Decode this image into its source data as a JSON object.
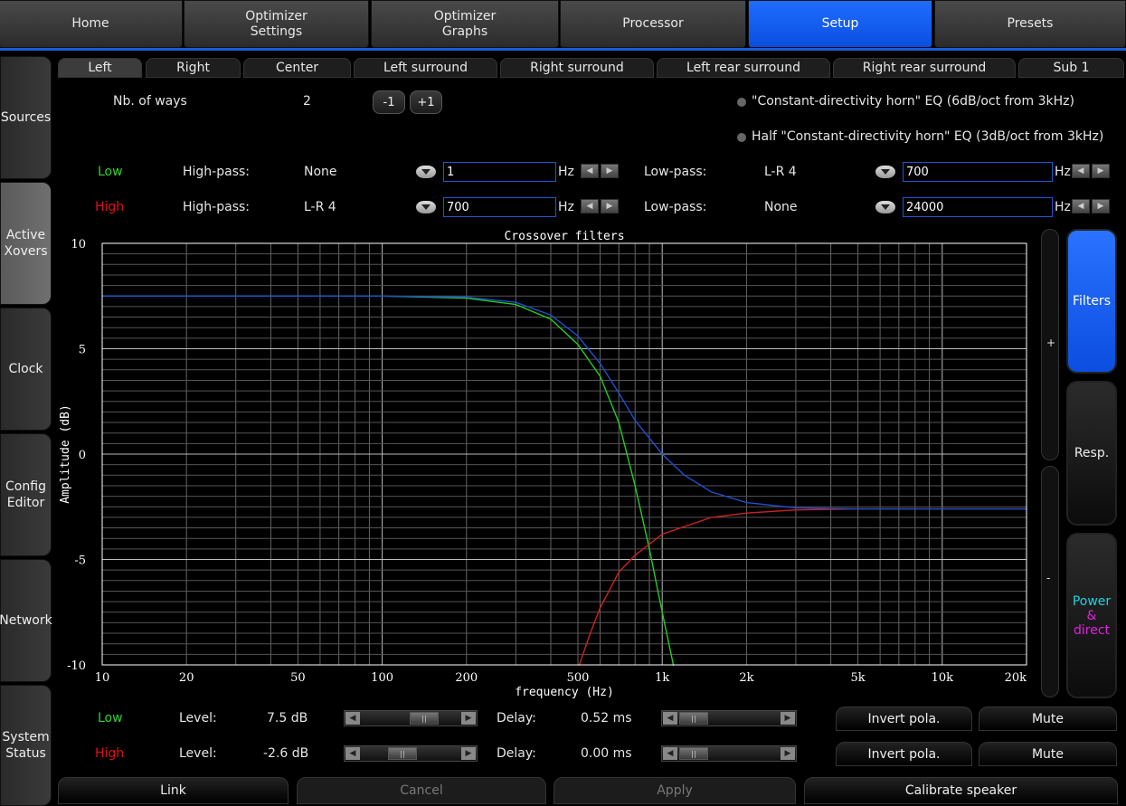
{
  "top_tabs": [
    {
      "label": "Home"
    },
    {
      "label": "Optimizer\nSettings"
    },
    {
      "label": "Optimizer\nGraphs"
    },
    {
      "label": "Processor"
    },
    {
      "label": "Setup",
      "active": true
    },
    {
      "label": "Presets"
    }
  ],
  "sidebar": [
    {
      "label": "Sources"
    },
    {
      "label": "Active\nXovers",
      "active": true
    },
    {
      "label": "Clock"
    },
    {
      "label": "Config\nEditor"
    },
    {
      "label": "Network"
    },
    {
      "label": "System\nStatus"
    }
  ],
  "channel_tabs": [
    "Left",
    "Right",
    "Center",
    "Left surround",
    "Right surround",
    "Left rear surround",
    "Right rear surround",
    "Sub 1"
  ],
  "active_channel": "Left",
  "ways": {
    "label": "Nb. of ways",
    "value": "2",
    "minus": "-1",
    "plus": "+1"
  },
  "eq_options": [
    "\"Constant-directivity horn\" EQ (6dB/oct from 3kHz)",
    "Half \"Constant-directivity horn\" EQ (3dB/oct from 3kHz)"
  ],
  "bands": [
    {
      "name": "Low",
      "color": "#2fd12f",
      "hp_label": "High-pass:",
      "hp_type": "None",
      "hp_freq": "1",
      "unit": "Hz",
      "lp_label": "Low-pass:",
      "lp_type": "L-R 4",
      "lp_freq": "700"
    },
    {
      "name": "High",
      "color": "#e01010",
      "hp_label": "High-pass:",
      "hp_type": "L-R 4",
      "hp_freq": "700",
      "unit": "Hz",
      "lp_label": "Low-pass:",
      "lp_type": "None",
      "lp_freq": "24000"
    }
  ],
  "levels": [
    {
      "name": "Low",
      "color": "#2fd12f",
      "level_label": "Level:",
      "level": "7.5 dB",
      "delay_label": "Delay:",
      "delay": "0.52 ms",
      "invert": "Invert pola.",
      "mute": "Mute"
    },
    {
      "name": "High",
      "color": "#e01010",
      "level_label": "Level:",
      "level": "-2.6 dB",
      "delay_label": "Delay:",
      "delay": "0.00 ms",
      "invert": "Invert pola.",
      "mute": "Mute"
    }
  ],
  "right_panel": {
    "plus": "+",
    "minus": "-",
    "filters": "Filters",
    "resp": "Resp.",
    "power_line1": "Power",
    "power_line2": "& direct"
  },
  "bottom": {
    "link": "Link",
    "cancel": "Cancel",
    "apply": "Apply",
    "calibrate": "Calibrate speaker"
  },
  "chart_data": {
    "type": "line",
    "title": "Crossover filters",
    "xlabel": "frequency (Hz)",
    "ylabel": "Amplitude (dB)",
    "xscale": "log",
    "xlim": [
      10,
      20000
    ],
    "ylim": [
      -10,
      10
    ],
    "xticks": [
      10,
      20,
      50,
      100,
      200,
      500,
      1000,
      2000,
      5000,
      10000,
      20000
    ],
    "xticklabels": [
      "10",
      "20",
      "50",
      "100",
      "200",
      "500",
      "1k",
      "2k",
      "5k",
      "10k",
      "20k"
    ],
    "yticks": [
      -10,
      -5,
      0,
      5,
      10
    ],
    "yticklabels": [
      "-10",
      "-5",
      "0",
      "5",
      "10"
    ],
    "grid": true,
    "series": [
      {
        "color": "#22cc22",
        "x": [
          10,
          100,
          200,
          300,
          400,
          500,
          600,
          700,
          800,
          900,
          1000,
          1100,
          1200
        ],
        "y": [
          7.5,
          7.5,
          7.4,
          7.1,
          6.4,
          5.2,
          3.7,
          1.5,
          -1.5,
          -4.5,
          -7.5,
          -10.1,
          -12.5
        ]
      },
      {
        "color": "#cc2222",
        "x": [
          500,
          550,
          600,
          700,
          800,
          1000,
          1500,
          2000,
          3000,
          5000,
          10000,
          20000
        ],
        "y": [
          -10.2,
          -8.6,
          -7.3,
          -5.6,
          -4.8,
          -3.8,
          -3.0,
          -2.8,
          -2.65,
          -2.6,
          -2.6,
          -2.6
        ]
      },
      {
        "color": "#1e4fd0",
        "x": [
          10,
          100,
          200,
          300,
          400,
          500,
          600,
          700,
          800,
          1000,
          1200,
          1500,
          2000,
          3000,
          5000,
          10000,
          20000
        ],
        "y": [
          7.5,
          7.5,
          7.45,
          7.2,
          6.6,
          5.6,
          4.3,
          2.9,
          1.6,
          0.0,
          -1.0,
          -1.8,
          -2.3,
          -2.55,
          -2.6,
          -2.6,
          -2.6
        ]
      }
    ]
  }
}
